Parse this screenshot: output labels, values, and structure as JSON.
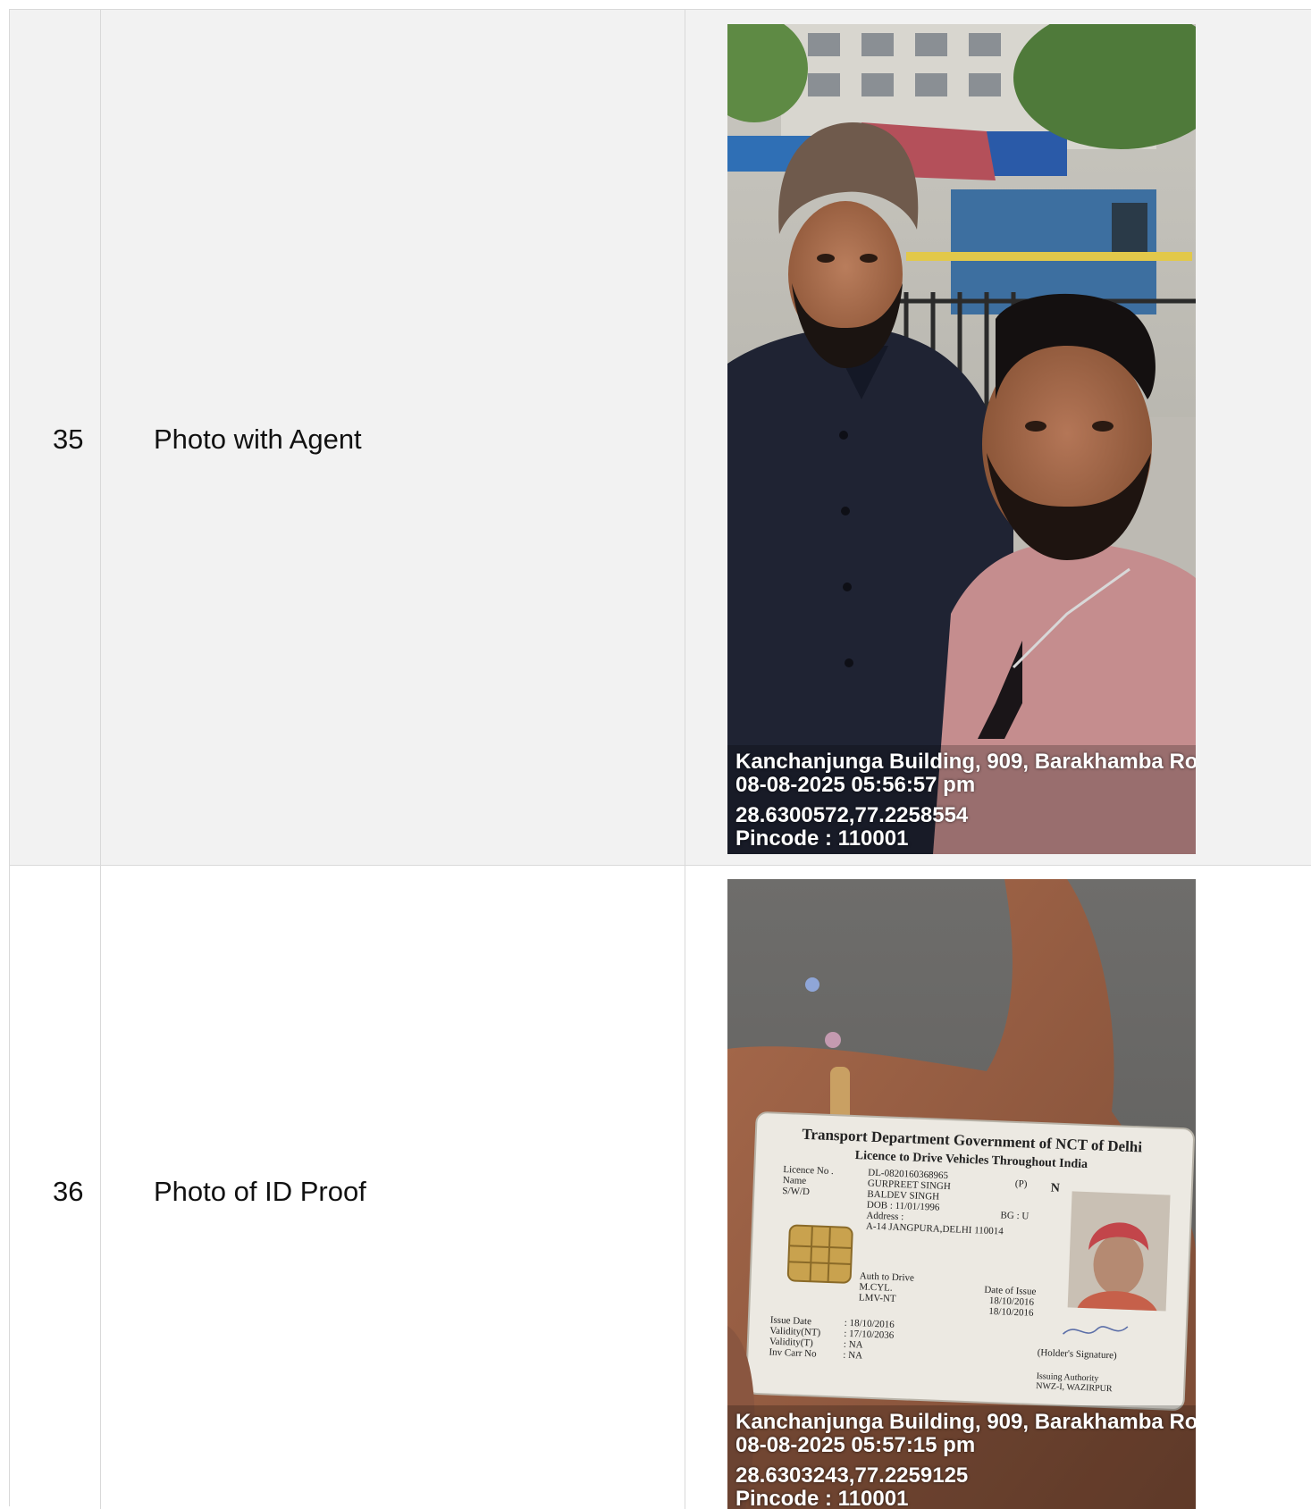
{
  "rows": [
    {
      "number": "35",
      "label": "Photo with Agent",
      "photo": {
        "stamp_address": "Kanchanjunga Building, 909, Barakhamba Ro",
        "stamp_datetime": "08-08-2025 05:56:57 pm",
        "stamp_coords": "28.6300572,77.2258554",
        "stamp_pincode": "Pincode : 110001"
      }
    },
    {
      "number": "36",
      "label": "Photo of ID Proof",
      "photo": {
        "stamp_address": "Kanchanjunga Building, 909, Barakhamba Ro",
        "stamp_datetime": "08-08-2025 05:57:15 pm",
        "stamp_coords": "28.6303243,77.2259125",
        "stamp_pincode": "Pincode : 110001",
        "card": {
          "title": "Transport Department Government of NCT of Delhi",
          "subtitle": "Licence to Drive Vehicles Throughout India",
          "licence_no_label": "Licence No .",
          "licence_no": "DL-0820160368965",
          "name_label": "Name",
          "name": "GURPREET SINGH",
          "swd_label": "S/W/D",
          "swd": "BALDEV SINGH",
          "p_mark": "(P)",
          "n_mark": "N",
          "dob": "DOB :   11/01/1996",
          "bg": "BG :  U",
          "address_label": "Address :",
          "address": "A-14 JANGPURA,DELHI 110014",
          "auth_label": "Auth to Drive",
          "auth_1": "M.CYL.",
          "auth_2": "LMV-NT",
          "doi_label": "Date of Issue",
          "doi_1": "18/10/2016",
          "doi_2": "18/10/2016",
          "issue_date_label": "Issue Date",
          "issue_date": ": 18/10/2016",
          "validity_nt_label": "Validity(NT)",
          "validity_nt": ": 17/10/2036",
          "validity_t_label": "Validity(T)",
          "validity_t": ": NA",
          "inv_label": "Inv Carr No",
          "inv": ": NA",
          "holder_sig": "(Holder's Signature)",
          "issuing_authority": "Issuing Authority",
          "issuing_office": "NWZ-I, WAZIRPUR"
        }
      }
    }
  ]
}
